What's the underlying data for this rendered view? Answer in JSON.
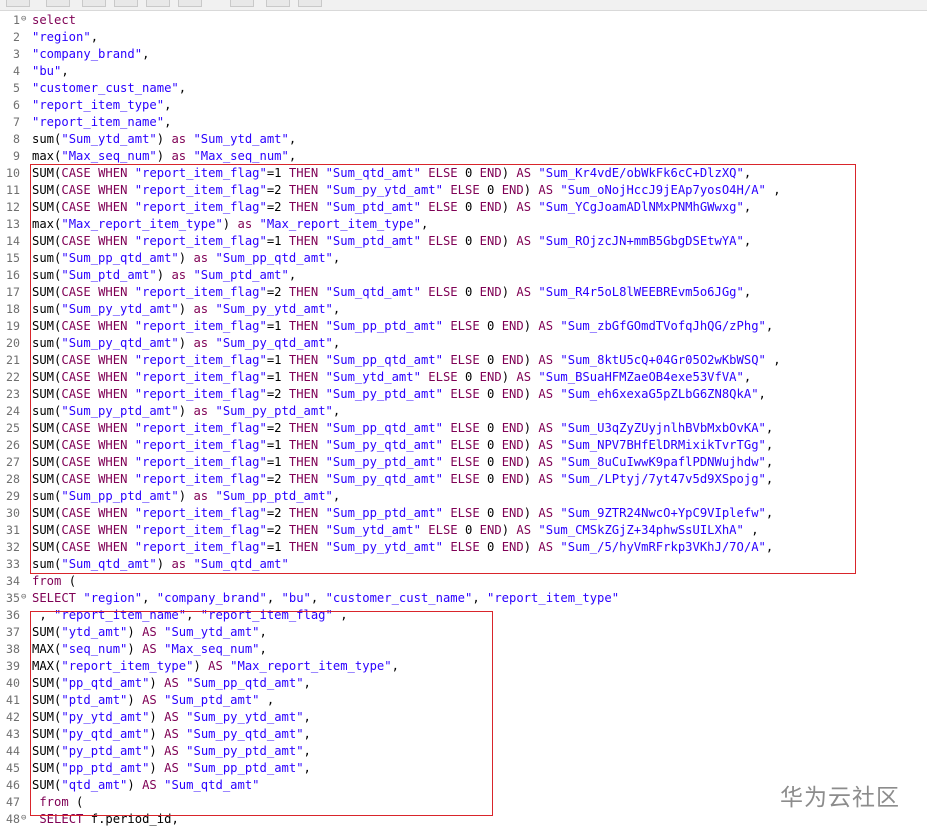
{
  "watermark": "华为云社区",
  "code_lines": [
    {
      "n": "1",
      "fold": true,
      "t": "select"
    },
    {
      "n": "2",
      "t": "\"region\","
    },
    {
      "n": "3",
      "t": "\"company_brand\","
    },
    {
      "n": "4",
      "t": "\"bu\","
    },
    {
      "n": "5",
      "t": "\"customer_cust_name\","
    },
    {
      "n": "6",
      "t": "\"report_item_type\","
    },
    {
      "n": "7",
      "t": "\"report_item_name\","
    },
    {
      "n": "8",
      "t": "sum(\"Sum_ytd_amt\") as \"Sum_ytd_amt\","
    },
    {
      "n": "9",
      "t": "max(\"Max_seq_num\") as \"Max_seq_num\","
    },
    {
      "n": "10",
      "t": "SUM(CASE WHEN \"report_item_flag\"=1 THEN \"Sum_qtd_amt\" ELSE 0 END) AS \"Sum_Kr4vdE/obWkFk6cC+DlzXQ\","
    },
    {
      "n": "11",
      "t": "SUM(CASE WHEN \"report_item_flag\"=2 THEN \"Sum_py_ytd_amt\" ELSE 0 END) AS \"Sum_oNojHccJ9jEAp7yosO4H/A\" ,"
    },
    {
      "n": "12",
      "t": "SUM(CASE WHEN \"report_item_flag\"=2 THEN \"Sum_ptd_amt\" ELSE 0 END) AS \"Sum_YCgJoamADlNMxPNMhGWwxg\","
    },
    {
      "n": "13",
      "t": "max(\"Max_report_item_type\") as \"Max_report_item_type\","
    },
    {
      "n": "14",
      "t": "SUM(CASE WHEN \"report_item_flag\"=1 THEN \"Sum_ptd_amt\" ELSE 0 END) AS \"Sum_ROjzcJN+mmB5GbgDSEtwYA\","
    },
    {
      "n": "15",
      "t": "sum(\"Sum_pp_qtd_amt\") as \"Sum_pp_qtd_amt\","
    },
    {
      "n": "16",
      "t": "sum(\"Sum_ptd_amt\") as \"Sum_ptd_amt\","
    },
    {
      "n": "17",
      "t": "SUM(CASE WHEN \"report_item_flag\"=2 THEN \"Sum_qtd_amt\" ELSE 0 END) AS \"Sum_R4r5oL8lWEEBREvm5o6JGg\","
    },
    {
      "n": "18",
      "t": "sum(\"Sum_py_ytd_amt\") as \"Sum_py_ytd_amt\","
    },
    {
      "n": "19",
      "t": "SUM(CASE WHEN \"report_item_flag\"=1 THEN \"Sum_pp_ptd_amt\" ELSE 0 END) AS \"Sum_zbGfGOmdTVofqJhQG/zPhg\","
    },
    {
      "n": "20",
      "t": "sum(\"Sum_py_qtd_amt\") as \"Sum_py_qtd_amt\","
    },
    {
      "n": "21",
      "t": "SUM(CASE WHEN \"report_item_flag\"=1 THEN \"Sum_pp_qtd_amt\" ELSE 0 END) AS \"Sum_8ktU5cQ+04Gr05O2wKbWSQ\" ,"
    },
    {
      "n": "22",
      "t": "SUM(CASE WHEN \"report_item_flag\"=1 THEN \"Sum_ytd_amt\" ELSE 0 END) AS \"Sum_BSuaHFMZaeOB4exe53VfVA\","
    },
    {
      "n": "23",
      "t": "SUM(CASE WHEN \"report_item_flag\"=2 THEN \"Sum_py_ptd_amt\" ELSE 0 END) AS \"Sum_eh6xexaG5pZLbG6ZN8QkA\","
    },
    {
      "n": "24",
      "t": "sum(\"Sum_py_ptd_amt\") as \"Sum_py_ptd_amt\","
    },
    {
      "n": "25",
      "t": "SUM(CASE WHEN \"report_item_flag\"=2 THEN \"Sum_pp_qtd_amt\" ELSE 0 END) AS \"Sum_U3qZyZUyjnlhBVbMxbOvKA\","
    },
    {
      "n": "26",
      "t": "SUM(CASE WHEN \"report_item_flag\"=1 THEN \"Sum_py_qtd_amt\" ELSE 0 END) AS \"Sum_NPV7BHfElDRMixikTvrTGg\","
    },
    {
      "n": "27",
      "t": "SUM(CASE WHEN \"report_item_flag\"=1 THEN \"Sum_py_ptd_amt\" ELSE 0 END) AS \"Sum_8uCuIwwK9paflPDNWujhdw\","
    },
    {
      "n": "28",
      "t": "SUM(CASE WHEN \"report_item_flag\"=2 THEN \"Sum_py_qtd_amt\" ELSE 0 END) AS \"Sum_/LPtyj/7yt47v5d9XSpojg\","
    },
    {
      "n": "29",
      "t": "sum(\"Sum_pp_ptd_amt\") as \"Sum_pp_ptd_amt\","
    },
    {
      "n": "30",
      "t": "SUM(CASE WHEN \"report_item_flag\"=2 THEN \"Sum_pp_ptd_amt\" ELSE 0 END) AS \"Sum_9ZTR24NwcO+YpC9VIplefw\","
    },
    {
      "n": "31",
      "t": "SUM(CASE WHEN \"report_item_flag\"=2 THEN \"Sum_ytd_amt\" ELSE 0 END) AS \"Sum_CMSkZGjZ+34phwSsUILXhA\" ,"
    },
    {
      "n": "32",
      "t": "SUM(CASE WHEN \"report_item_flag\"=1 THEN \"Sum_py_ytd_amt\" ELSE 0 END) AS \"Sum_/5/hyVmRFrkp3VKhJ/7O/A\","
    },
    {
      "n": "33",
      "t": "sum(\"Sum_qtd_amt\") as \"Sum_qtd_amt\""
    },
    {
      "n": "34",
      "t": "from ("
    },
    {
      "n": "35",
      "fold": true,
      "t": "SELECT \"region\", \"company_brand\", \"bu\", \"customer_cust_name\", \"report_item_type\""
    },
    {
      "n": "36",
      "t": " , \"report_item_name\", \"report_item_flag\" ,"
    },
    {
      "n": "37",
      "t": "SUM(\"ytd_amt\") AS \"Sum_ytd_amt\","
    },
    {
      "n": "38",
      "t": "MAX(\"seq_num\") AS \"Max_seq_num\","
    },
    {
      "n": "39",
      "t": "MAX(\"report_item_type\") AS \"Max_report_item_type\","
    },
    {
      "n": "40",
      "t": "SUM(\"pp_qtd_amt\") AS \"Sum_pp_qtd_amt\","
    },
    {
      "n": "41",
      "t": "SUM(\"ptd_amt\") AS \"Sum_ptd_amt\" ,"
    },
    {
      "n": "42",
      "t": "SUM(\"py_ytd_amt\") AS \"Sum_py_ytd_amt\","
    },
    {
      "n": "43",
      "t": "SUM(\"py_qtd_amt\") AS \"Sum_py_qtd_amt\","
    },
    {
      "n": "44",
      "t": "SUM(\"py_ptd_amt\") AS \"Sum_py_ptd_amt\","
    },
    {
      "n": "45",
      "t": "SUM(\"pp_ptd_amt\") AS \"Sum_pp_ptd_amt\","
    },
    {
      "n": "46",
      "t": "SUM(\"qtd_amt\") AS \"Sum_qtd_amt\""
    },
    {
      "n": "47",
      "t": " from ("
    },
    {
      "n": "48",
      "fold": true,
      "t": " SELECT f.period_id,"
    }
  ],
  "colors": {
    "keyword": "#7f0055",
    "string": "#2a00ff",
    "plain": "#000000",
    "line_number": "#6f6f6f",
    "highlight_box": "#d9252b"
  }
}
